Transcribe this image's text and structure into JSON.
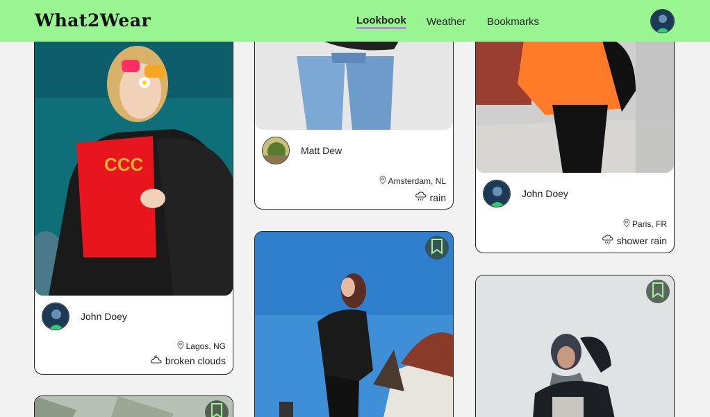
{
  "header": {
    "logo": "What2Wear",
    "nav": [
      {
        "label": "Lookbook",
        "active": true
      },
      {
        "label": "Weather",
        "active": false
      },
      {
        "label": "Bookmarks",
        "active": false
      }
    ]
  },
  "posts": [
    {
      "user": "John Doey",
      "location": "Lagos, NG",
      "weather": "broken clouds",
      "weather_icon": "broken-clouds-icon"
    },
    {
      "user": "Matt Dew",
      "location": "Amsterdam, NL",
      "weather": "rain",
      "weather_icon": "rain-icon"
    },
    {
      "user": "John Doey",
      "location": "Paris, FR",
      "weather": "shower rain",
      "weather_icon": "shower-rain-icon"
    }
  ],
  "colors": {
    "header_bg": "#98f591",
    "nav_underline": "#b98ad9",
    "bookmark_icon": "#98f591"
  }
}
